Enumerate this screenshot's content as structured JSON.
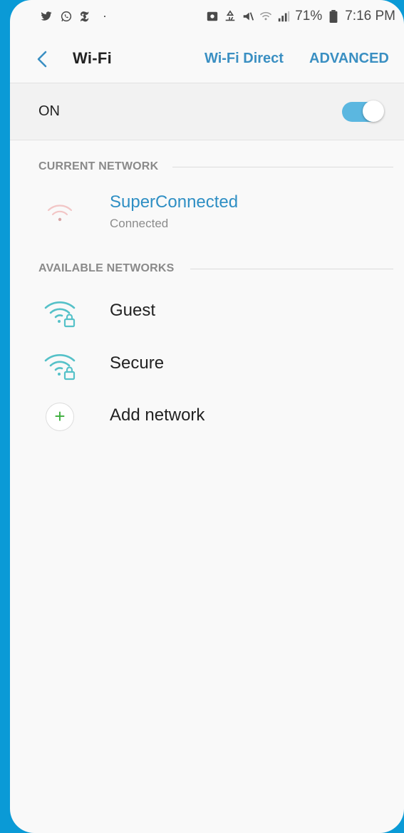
{
  "status_bar": {
    "icons_left": [
      "twitter-icon",
      "whatsapp-icon",
      "nytimes-icon",
      "dot-icon"
    ],
    "icons_right": [
      "photo-icon",
      "recycle-icon",
      "mute-icon",
      "wifi-signal-icon",
      "cell-signal-icon",
      "battery-icon"
    ],
    "battery": "71%",
    "time": "7:16 PM"
  },
  "header": {
    "title": "Wi-Fi",
    "wifi_direct": "Wi-Fi Direct",
    "advanced": "ADVANCED"
  },
  "toggle": {
    "label": "ON",
    "on": true,
    "accent": "#5bb7e0"
  },
  "current_network": {
    "section_title": "CURRENT NETWORK",
    "name": "SuperConnected",
    "status": "Connected"
  },
  "available_networks": {
    "section_title": "AVAILABLE NETWORKS",
    "items": [
      {
        "name": "Guest",
        "icon": "wifi-lock-icon"
      },
      {
        "name": "Secure",
        "icon": "wifi-lock-icon"
      }
    ],
    "add_network": "Add network"
  },
  "colors": {
    "accent": "#3a8fc2",
    "frame": "#0a9ad6",
    "add_plus": "#3cae3c"
  }
}
